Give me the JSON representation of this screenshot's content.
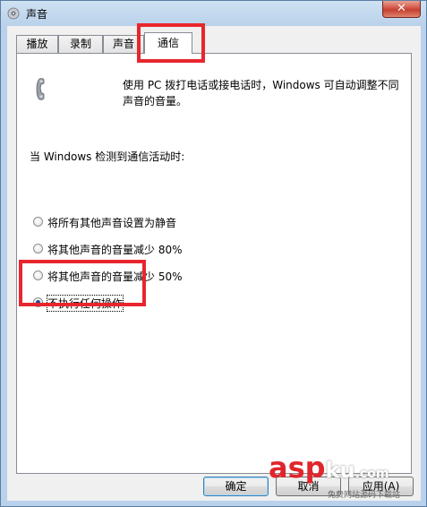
{
  "window": {
    "title": "声音",
    "close_glyph": "✕"
  },
  "tabs": [
    {
      "label": "播放",
      "active": false
    },
    {
      "label": "录制",
      "active": false
    },
    {
      "label": "声音",
      "active": false
    },
    {
      "label": "通信",
      "active": true
    }
  ],
  "comm": {
    "icon": "phone-icon",
    "description": "使用 PC 拨打电话或接电话时，Windows 可自动调整不同声音的音量。",
    "heading": "当 Windows 检测到通信活动时:",
    "options": [
      {
        "label": "将所有其他声音设置为静音",
        "selected": false
      },
      {
        "label": "将其他声音的音量减少 80%",
        "selected": false
      },
      {
        "label": "将其他声音的音量减少 50%",
        "selected": false
      },
      {
        "label": "不执行任何操作",
        "selected": true
      }
    ]
  },
  "buttons": {
    "ok": "确定",
    "cancel": "取消",
    "apply": "应用(A)"
  },
  "watermark": {
    "brand": "asp",
    "brand_suffix": "ku",
    "domain": ".com",
    "tagline": "免费网站源码下载站"
  },
  "colors": {
    "annotation": "#e8262d",
    "accent": "#3c7fb1"
  }
}
